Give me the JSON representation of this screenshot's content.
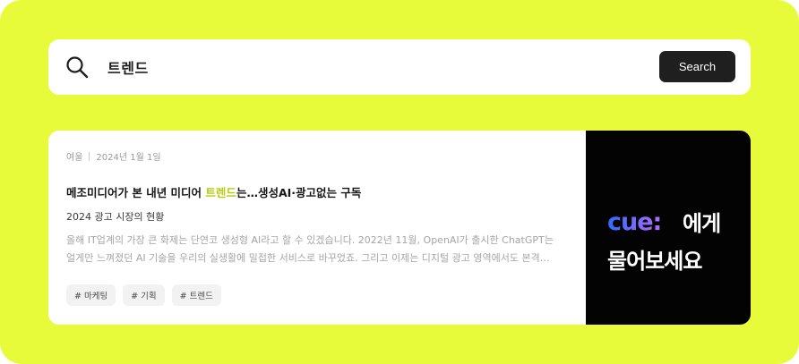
{
  "search": {
    "query": "트렌드",
    "button_label": "Search"
  },
  "card": {
    "meta": {
      "author": "여울",
      "date": "2024년 1월 1일"
    },
    "title": {
      "prefix": "메조미디어가 본 내년 미디어 ",
      "highlight": "트렌드",
      "suffix": "는…생성AI·광고없는 구독"
    },
    "subtitle": "2024 광고 시장의 현황",
    "summary_lines": [
      "올해 IT업계의 가장 큰 화제는 단연코 생성형 AI라고 할 수 있겠습니다. 2022년 11월, OpenAI가 출시한 ChatGPT는",
      "얼게만 느껴졌던 AI 기술을 우리의 실생활에 밀접한 서비스로 바꾸었죠. 그리고 이제는 디지털 광고 영역에서도 본격…"
    ],
    "tags": [
      "# 마케팅",
      "# 기획",
      "# 트렌드"
    ],
    "thumbnail": {
      "logo_text": "cue:",
      "line1": "에게",
      "line2": "물어보세요"
    }
  },
  "colors": {
    "background": "#e8fb3a",
    "highlight": "#b5cc12",
    "button": "#1f1f1f",
    "thumbnail_bg": "#030303",
    "logo_gradient_start": "#2f6bff",
    "logo_gradient_end": "#b56bff"
  },
  "icons": {
    "search": "search-icon",
    "logo": "cue-logo"
  }
}
